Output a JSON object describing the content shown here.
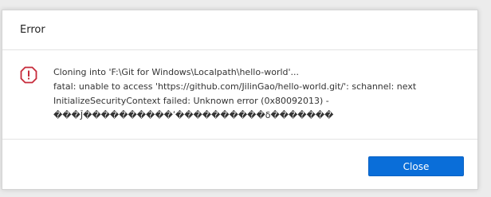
{
  "dialog": {
    "title": "Error",
    "icon": "error-icon",
    "accent_color": "#c62a3a",
    "message_lines": [
      "Cloning into 'F:\\Git for Windows\\Localpath\\hello-world'...",
      "fatal: unable to access 'https://github.com/JilinGao/hello-world.git/': schannel: next",
      "InitializeSecurityContext failed: Unknown error (0x80092013) -",
      "���Ĵ����������ʹ����������δ�������"
    ],
    "close_label": "Close",
    "button_color": "#0a6ed9"
  }
}
